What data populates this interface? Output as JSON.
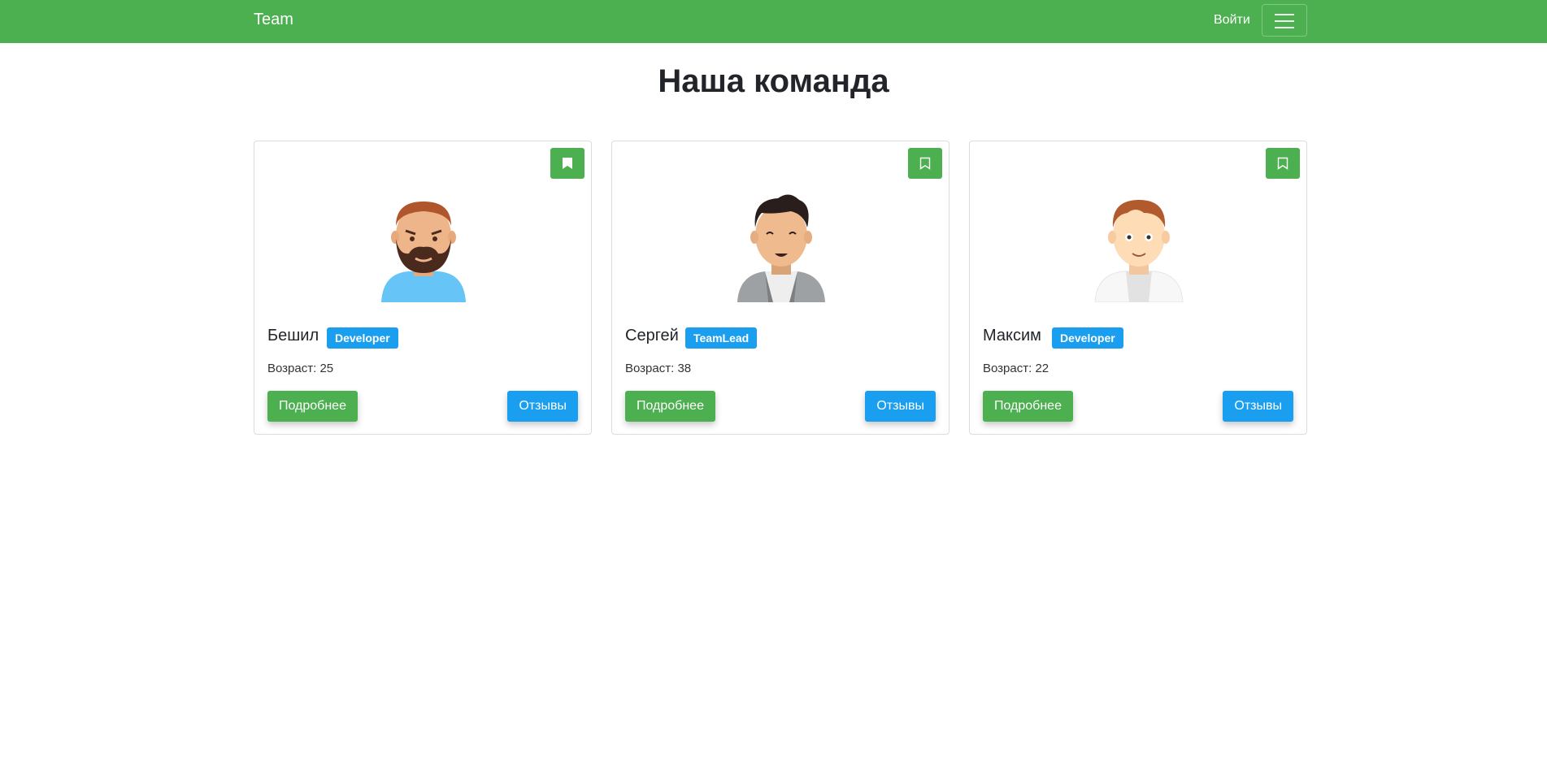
{
  "navbar": {
    "brand": "Team",
    "login": "Войти"
  },
  "page": {
    "title": "Наша команда"
  },
  "members": [
    {
      "name": "Бешил",
      "role": "Developer",
      "age_text": "Возраст: 25",
      "details": "Подробнее",
      "reviews": "Отзывы",
      "bookmarked": true
    },
    {
      "name": "Сергей",
      "role": "TeamLead",
      "age_text": "Возраст: 38",
      "details": "Подробнее",
      "reviews": "Отзывы",
      "bookmarked": false
    },
    {
      "name": "Максим",
      "role": "Developer",
      "age_text": "Возраст: 22",
      "details": "Подробнее",
      "reviews": "Отзывы",
      "bookmarked": false
    }
  ],
  "colors": {
    "primary_green": "#4caf50",
    "badge_blue": "#1a9ef0"
  }
}
